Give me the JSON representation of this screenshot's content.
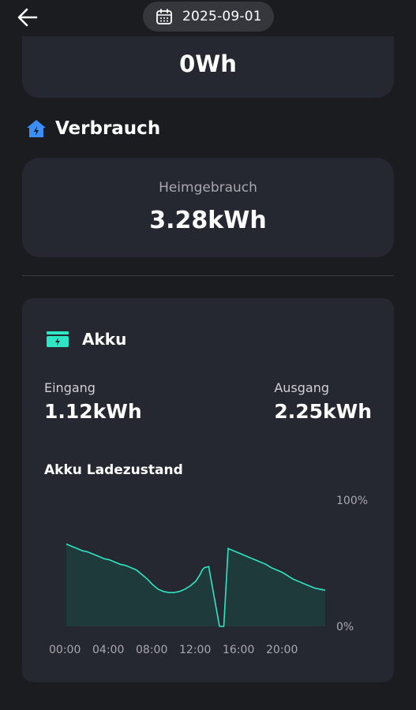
{
  "header": {
    "date": "2025-09-01"
  },
  "top_card": {
    "value": "0Wh"
  },
  "consumption": {
    "title": "Verbrauch",
    "home_label": "Heimgebrauch",
    "home_value": "3.28kWh"
  },
  "battery": {
    "title": "Akku",
    "input_label": "Eingang",
    "input_value": "1.12kWh",
    "output_label": "Ausgang",
    "output_value": "2.25kWh",
    "chart_title": "Akku Ladezustand"
  },
  "colors": {
    "accent": "#2ee6c4",
    "fill": "#1f3a3b",
    "card": "#252830",
    "background": "#1b1c1f",
    "icon_blue": "#3a8ef6"
  },
  "chart_data": {
    "type": "area",
    "title": "Akku Ladezustand",
    "xlabel": "",
    "ylabel": "",
    "y_tick_labels": [
      "100%",
      "0%"
    ],
    "x_tick_labels": [
      "00:00",
      "04:00",
      "08:00",
      "12:00",
      "16:00",
      "20:00"
    ],
    "ylim": [
      0,
      100
    ],
    "xlim": [
      0,
      24
    ],
    "grid": false,
    "series": [
      {
        "x": [
          0,
          0.5,
          1,
          1.5,
          2,
          2.5,
          3,
          3.5,
          4,
          4.5,
          5,
          5.5,
          6,
          6.5,
          7,
          7.5,
          8,
          8.5,
          9,
          9.5,
          10,
          10.5,
          11,
          11.5,
          12,
          12.4,
          12.6,
          12.8,
          13.2,
          14.2,
          14.4,
          14.6,
          15,
          15.5,
          16,
          16.5,
          17,
          17.5,
          18,
          18.5,
          19,
          19.5,
          20,
          20.5,
          21,
          21.5,
          22,
          22.5,
          23,
          23.5,
          24
        ],
        "y": [
          73,
          71,
          69,
          67,
          66,
          64,
          62,
          60,
          59,
          57,
          55,
          54,
          52,
          50,
          46,
          42,
          37,
          33,
          31,
          30,
          30,
          31,
          33,
          36,
          40,
          46,
          50,
          52,
          53,
          0,
          0,
          0,
          69,
          67,
          65,
          63,
          61,
          59,
          57,
          55,
          52,
          50,
          48,
          45,
          42,
          40,
          38,
          36,
          34,
          33,
          32
        ]
      }
    ]
  }
}
